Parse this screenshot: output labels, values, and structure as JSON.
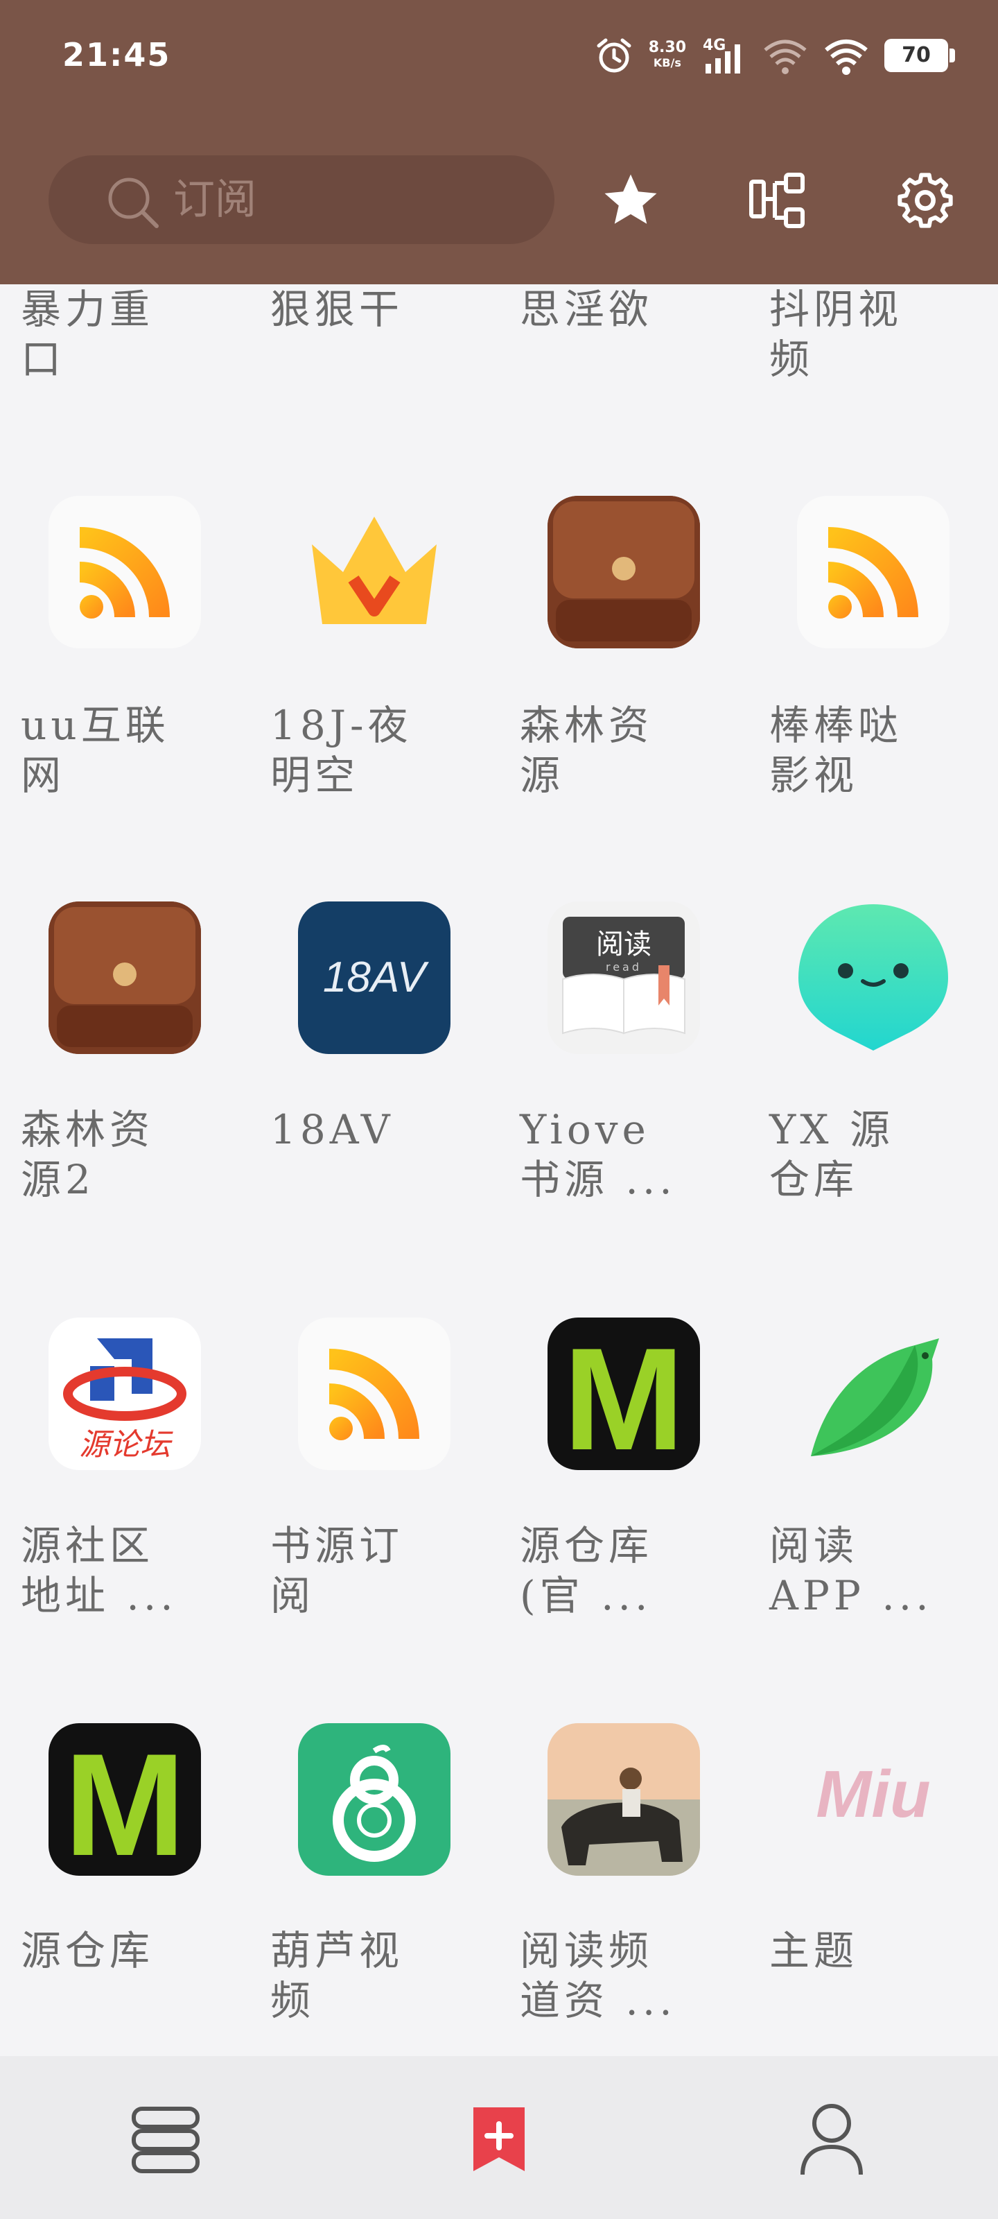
{
  "status": {
    "time": "21:45",
    "net_speed": "8.30",
    "net_unit": "KB/s",
    "network": "4G",
    "battery": "70"
  },
  "search": {
    "placeholder": "订阅"
  },
  "partial_row": [
    "暴力重\n口",
    "狠狠干",
    "思淫欲",
    "抖阴视\n频"
  ],
  "items": [
    {
      "label": "uu互联\n网",
      "icon": "rss-icon"
    },
    {
      "label": "18J-夜\n明空",
      "icon": "crown-icon"
    },
    {
      "label": "森林资\n源",
      "icon": "leather-wallet-icon"
    },
    {
      "label": "棒棒哒\n影视",
      "icon": "rss-icon"
    },
    {
      "label": "森林资\n源2",
      "icon": "leather-wallet-icon"
    },
    {
      "label": "18AV",
      "icon": "18av-icon",
      "icon_text": "18AV"
    },
    {
      "label": "Yiove\n书源 ...",
      "icon": "book-read-icon",
      "icon_text": "阅读",
      "icon_sub": "read"
    },
    {
      "label": "YX 源\n仓库",
      "icon": "ghost-icon"
    },
    {
      "label": "源社区\n地址 ...",
      "icon": "forum-logo-icon",
      "icon_text": "源论坛"
    },
    {
      "label": "书源订\n阅",
      "icon": "rss-icon"
    },
    {
      "label": "源仓库\n(官 ...",
      "icon": "m-icon",
      "icon_text": "M"
    },
    {
      "label": "阅读\nAPP ...",
      "icon": "green-bird-icon"
    },
    {
      "label": "源仓库",
      "icon": "m-icon",
      "icon_text": "M"
    },
    {
      "label": "葫芦视\n频",
      "icon": "gourd-icon"
    },
    {
      "label": "阅读频\n道资 ...",
      "icon": "buffalo-painting-icon"
    },
    {
      "label": "主题",
      "icon": "miu-icon",
      "icon_text": "Miu"
    }
  ],
  "bottom_nav": [
    "bookshelf-icon",
    "subscription-icon",
    "profile-icon"
  ],
  "colors": {
    "header": "#7a5548",
    "accent": "#e8414b",
    "background": "#f4f4f6"
  }
}
